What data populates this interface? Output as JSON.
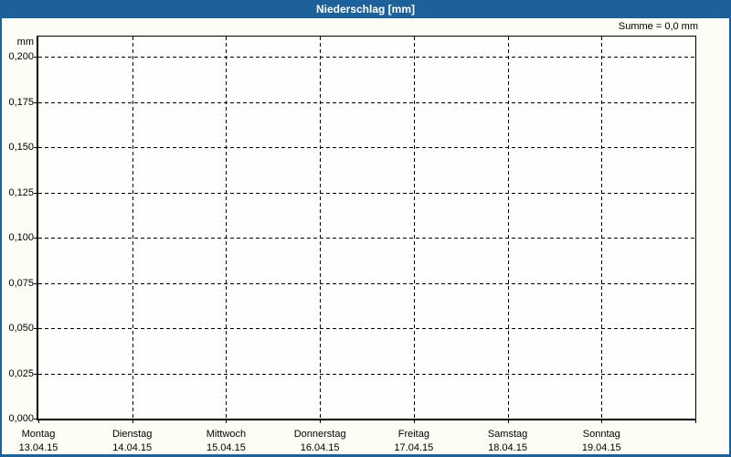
{
  "window": {
    "title": "Niederschlag [mm]"
  },
  "summary_label": "Summe = 0,0 mm",
  "axes": {
    "y_unit": "mm",
    "y_ticks": [
      {
        "label": "0,200",
        "value": 0.2
      },
      {
        "label": "0,175",
        "value": 0.175
      },
      {
        "label": "0,150",
        "value": 0.15
      },
      {
        "label": "0,125",
        "value": 0.125
      },
      {
        "label": "0,100",
        "value": 0.1
      },
      {
        "label": "0,075",
        "value": 0.075
      },
      {
        "label": "0,050",
        "value": 0.05
      },
      {
        "label": "0,025",
        "value": 0.025
      },
      {
        "label": "0,000",
        "value": 0.0
      }
    ],
    "x_days": [
      {
        "name": "Montag",
        "date": "13.04.15"
      },
      {
        "name": "Dienstag",
        "date": "14.04.15"
      },
      {
        "name": "Mittwoch",
        "date": "15.04.15"
      },
      {
        "name": "Donnerstag",
        "date": "16.04.15"
      },
      {
        "name": "Freitag",
        "date": "17.04.15"
      },
      {
        "name": "Samstag",
        "date": "18.04.15"
      },
      {
        "name": "Sonntag",
        "date": "19.04.15"
      }
    ]
  },
  "colors": {
    "titlebar": "#1d619a",
    "border": "#1d619a",
    "grid": "#000000",
    "plot_bg": "#fefefc",
    "panel_bg": "#fdfdf5"
  },
  "chart_data": {
    "type": "bar",
    "title": "Niederschlag [mm]",
    "categories": [
      "13.04.15",
      "14.04.15",
      "15.04.15",
      "16.04.15",
      "17.04.15",
      "18.04.15",
      "19.04.15"
    ],
    "category_day_names": [
      "Montag",
      "Dienstag",
      "Mittwoch",
      "Donnerstag",
      "Freitag",
      "Samstag",
      "Sonntag"
    ],
    "values": [
      0,
      0,
      0,
      0,
      0,
      0,
      0
    ],
    "xlabel": "",
    "ylabel": "mm",
    "ylim": [
      0,
      0.2
    ],
    "y_tick_step": 0.025,
    "grid": true,
    "legend": false,
    "annotation": "Summe = 0,0 mm"
  }
}
